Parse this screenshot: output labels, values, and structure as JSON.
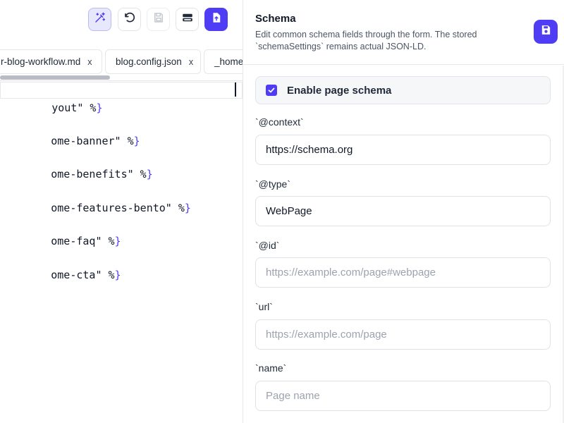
{
  "toolbar": {
    "magic_icon": "magic-wand-icon",
    "undo_icon": "undo-icon",
    "save_icon": "save-icon",
    "layout_icon": "layout-icon",
    "publish_icon": "publish-file-icon"
  },
  "tabs": [
    {
      "label": "r-blog-workflow.md",
      "close": "x"
    },
    {
      "label": "blog.config.json",
      "close": "x"
    },
    {
      "label": "_home-"
    }
  ],
  "code": {
    "lines": [
      {
        "text": "yout\" %",
        "brace": "}"
      },
      {
        "text": "ome-banner\" %",
        "brace": "}"
      },
      {
        "text": "ome-benefits\" %",
        "brace": "}"
      },
      {
        "text": "ome-features-bento\" %",
        "brace": "}"
      },
      {
        "text": "ome-faq\" %",
        "brace": "}"
      },
      {
        "text": "ome-cta\" %",
        "brace": "}"
      }
    ]
  },
  "panel": {
    "title": "Schema",
    "description": "Edit common schema fields through the form. The stored `schemaSettings` remains actual JSON-LD.",
    "save_icon": "save-icon",
    "enable_label": "Enable page schema",
    "enable_checked": true,
    "fields": {
      "context": {
        "label": "`@context`",
        "value": "https://schema.org",
        "placeholder": ""
      },
      "type": {
        "label": "`@type`",
        "value": "WebPage",
        "placeholder": ""
      },
      "id": {
        "label": "`@id`",
        "value": "",
        "placeholder": "https://example.com/page#webpage"
      },
      "url": {
        "label": "`url`",
        "value": "",
        "placeholder": "https://example.com/page"
      },
      "name": {
        "label": "`name`",
        "value": "",
        "placeholder": "Page name"
      }
    }
  },
  "colors": {
    "accent": "#4f3df5",
    "accent_soft": "#e7e8fb",
    "border": "#e5e7eb",
    "text": "#1f2937",
    "muted": "#9ca3af"
  }
}
